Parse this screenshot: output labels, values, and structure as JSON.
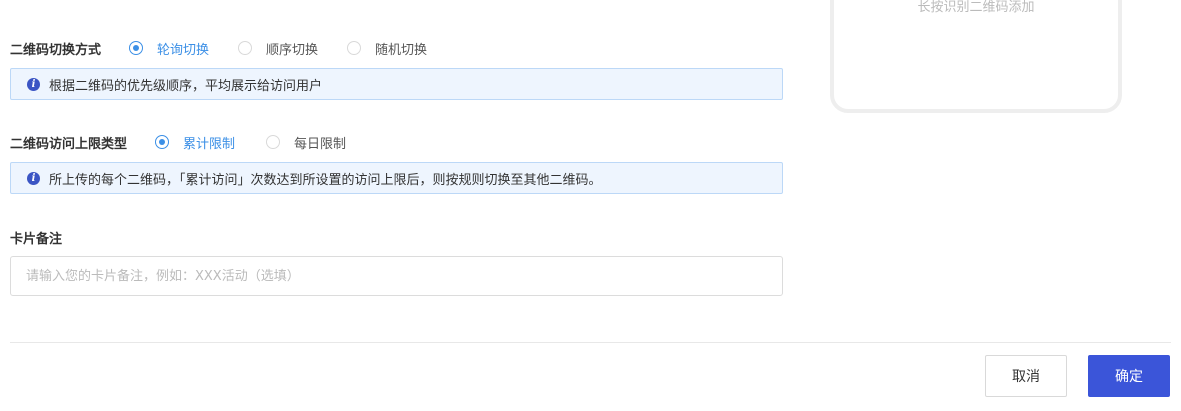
{
  "preview": {
    "hint": "长按识别二维码添加"
  },
  "switch_mode": {
    "label": "二维码切换方式",
    "options": [
      {
        "label": "轮询切换",
        "checked": true
      },
      {
        "label": "顺序切换",
        "checked": false
      },
      {
        "label": "随机切换",
        "checked": false
      }
    ],
    "info": "根据二维码的优先级顺序，平均展示给访问用户"
  },
  "limit_type": {
    "label": "二维码访问上限类型",
    "options": [
      {
        "label": "累计限制",
        "checked": true
      },
      {
        "label": "每日限制",
        "checked": false
      }
    ],
    "info": "所上传的每个二维码，「累计访问」次数达到所设置的访问上限后，则按规则切换至其他二维码。"
  },
  "card_note": {
    "label": "卡片备注",
    "value": "",
    "placeholder": "请输入您的卡片备注，例如：XXX活动（选填）"
  },
  "actions": {
    "cancel_label": "取消",
    "confirm_label": "确定"
  },
  "colors": {
    "accent": "#3b8fe6",
    "primary_button": "#3b55d9",
    "info_background": "#eef5fe",
    "info_border": "#bcd8f7"
  }
}
